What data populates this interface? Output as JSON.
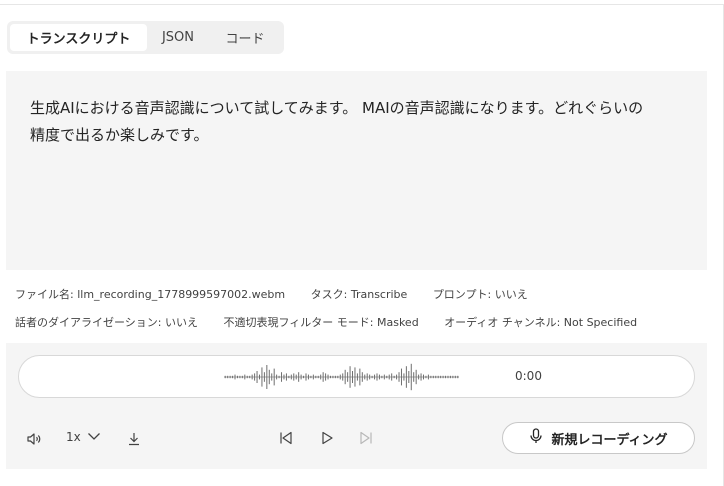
{
  "tabs": [
    {
      "label": "トランスクリプト",
      "active": true
    },
    {
      "label": "JSON",
      "active": false
    },
    {
      "label": "コード",
      "active": false
    }
  ],
  "transcript": {
    "line1": "生成AIにおける音声認識について試してみます。 MAIの音声認識になります。どれぐらいの",
    "line2": "精度で出るか楽しみです。"
  },
  "meta": {
    "file_label": "ファイル名:",
    "file_value": "llm_recording_1778999597002.webm",
    "task_label": "タスク:",
    "task_value": "Transcribe",
    "prompt_label": "プロンプト:",
    "prompt_value": "いいえ",
    "diarization_label": "話者のダイアライゼーション:",
    "diarization_value": "いいえ",
    "profanity_label": "不適切表現フィルター モード:",
    "profanity_value": "Masked",
    "channel_label": "オーディオ チャンネル:",
    "channel_value": "Not Specified"
  },
  "player": {
    "time": "0:00",
    "speed": "1x",
    "waveform": [
      1,
      1,
      1,
      1,
      2,
      1,
      1,
      1,
      2,
      1,
      1,
      2,
      3,
      5,
      2,
      8,
      4,
      10,
      6,
      3,
      7,
      2,
      1,
      4,
      2,
      3,
      1,
      2,
      3,
      2,
      4,
      2,
      1,
      3,
      2,
      1,
      2,
      1,
      1,
      2,
      4,
      3,
      2,
      1,
      1,
      1,
      1,
      2,
      3,
      6,
      4,
      9,
      5,
      8,
      3,
      7,
      4,
      2,
      3,
      2,
      1,
      2,
      3,
      2,
      1,
      2,
      1,
      2,
      3,
      1,
      2,
      4,
      7,
      3,
      9,
      5,
      11,
      4,
      6,
      2,
      3,
      2,
      1,
      2,
      1,
      1,
      1,
      1,
      1,
      1,
      1,
      1,
      1,
      1,
      1,
      1
    ]
  },
  "record_button": {
    "label": "新規レコーディング"
  },
  "colors": {
    "accent_bg": "#f5f5f5",
    "border": "#d8d8d8",
    "text": "#242424"
  }
}
